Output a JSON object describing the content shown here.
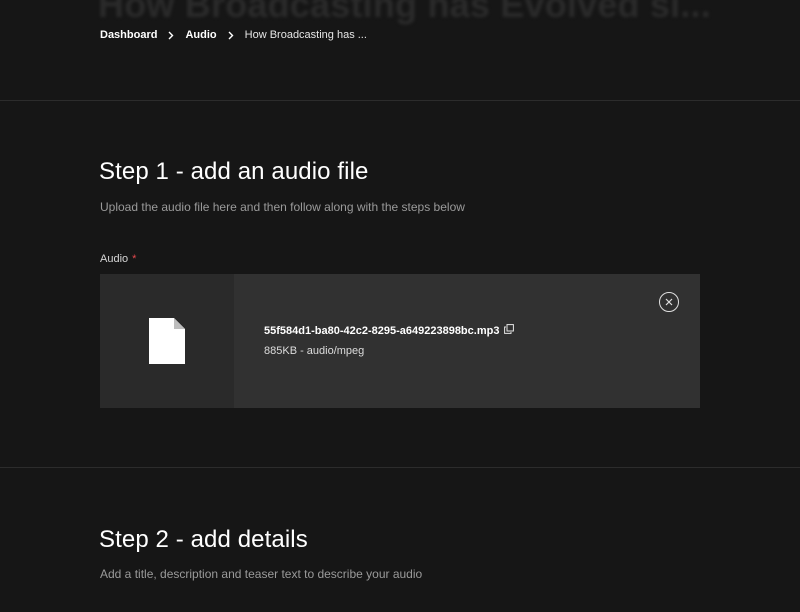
{
  "header": {
    "ghost_title": "How Broadcasting has Evolved si...",
    "breadcrumb": {
      "items": [
        "Dashboard",
        "Audio"
      ],
      "current": "How Broadcasting has ..."
    }
  },
  "step1": {
    "title": "Step 1 - add an audio file",
    "description": "Upload the audio file here and then follow along with the steps below",
    "field_label": "Audio",
    "required_mark": "*",
    "file": {
      "name": "55f584d1-ba80-42c2-8295-a649223898bc.mp3",
      "meta": "885KB - audio/mpeg"
    },
    "icons": {
      "file": "file-icon",
      "copy": "copy-icon",
      "remove": "close-circle-icon"
    }
  },
  "step2": {
    "title": "Step 2 - add details",
    "description": "Add a title, description and teaser text to describe your audio"
  },
  "colors": {
    "background": "#161616",
    "card": "#313131",
    "thumb": "#2a2a2a",
    "muted_text": "#9a9a9a",
    "required": "#e5484d"
  }
}
